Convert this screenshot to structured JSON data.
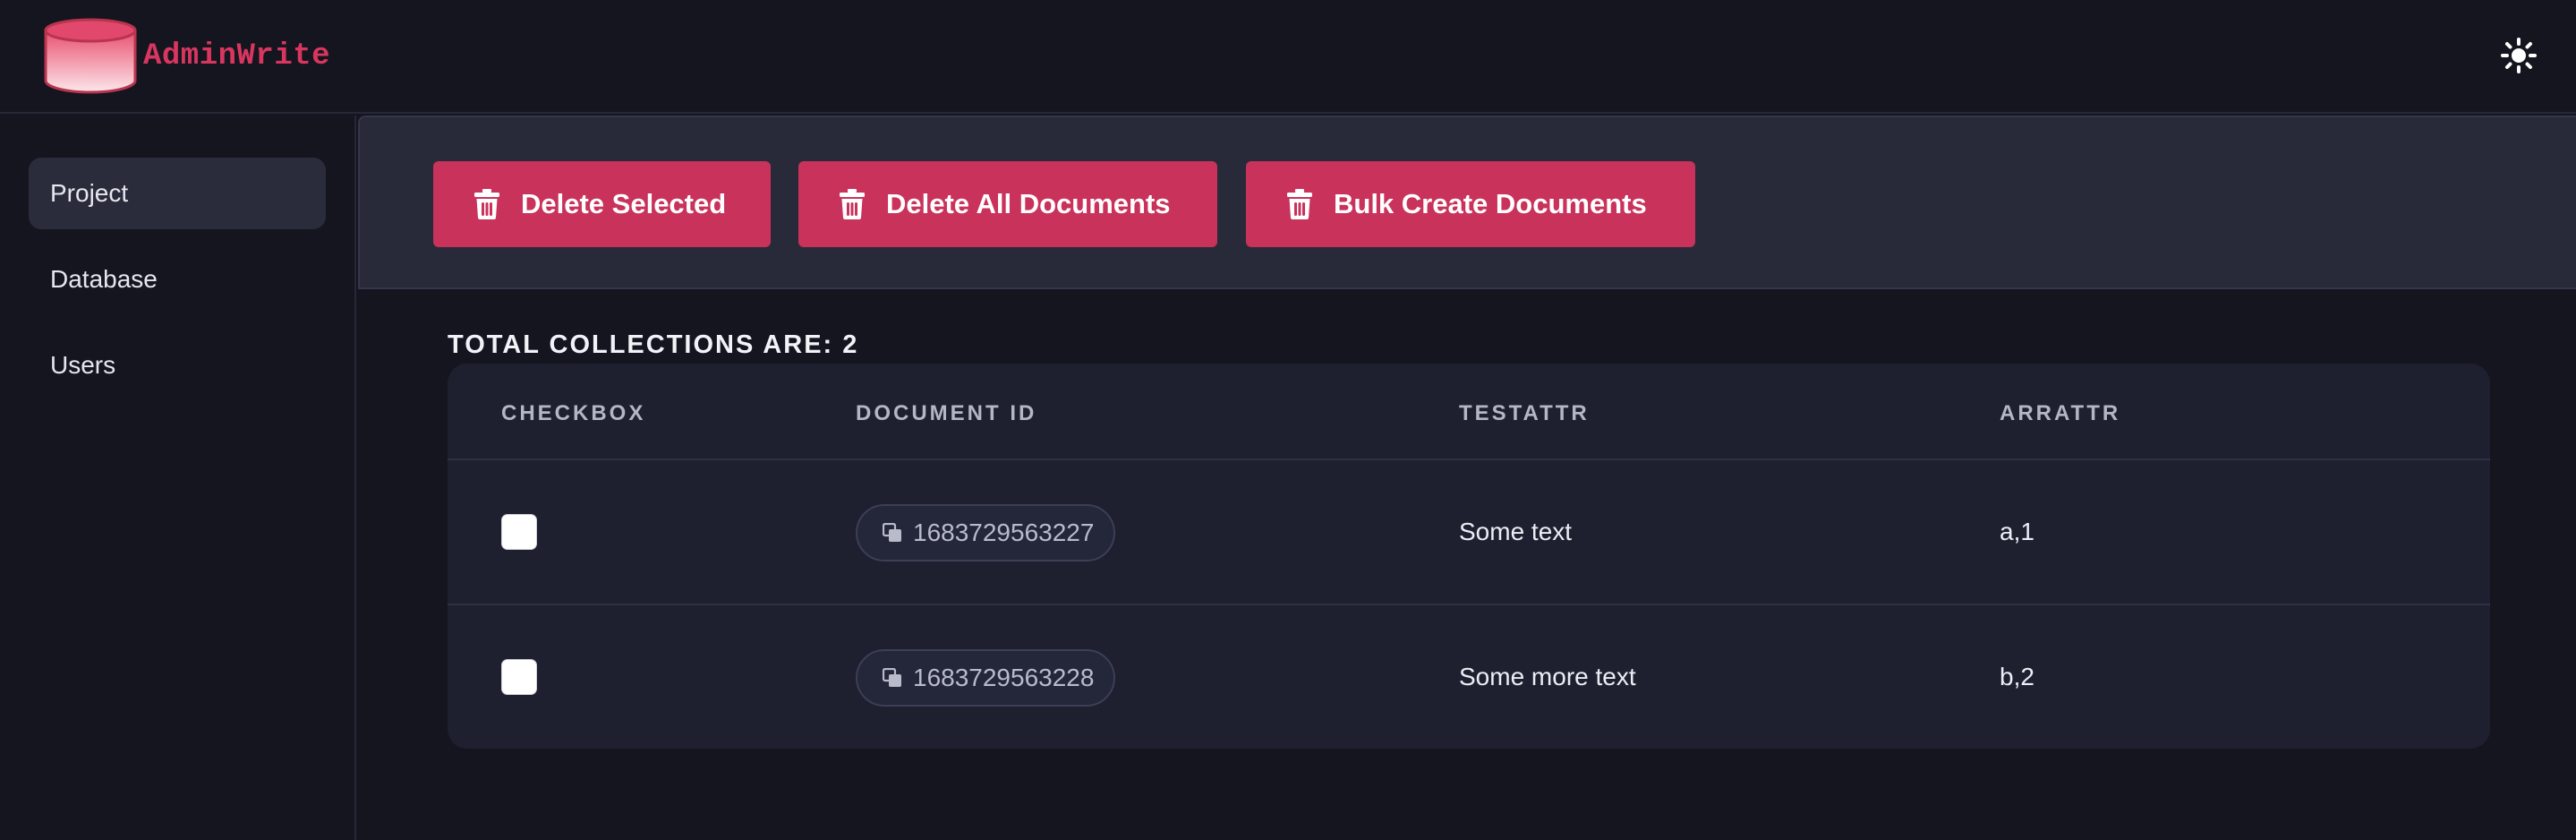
{
  "header": {
    "brand": "AdminWrite",
    "theme_icon": "sun-icon"
  },
  "sidebar": {
    "items": [
      {
        "label": "Project",
        "active": true
      },
      {
        "label": "Database",
        "active": false
      },
      {
        "label": "Users",
        "active": false
      }
    ]
  },
  "toolbar": {
    "delete_selected": "Delete Selected",
    "delete_all": "Delete All Documents",
    "bulk_create": "Bulk Create Documents",
    "button_icon": "trash-icon"
  },
  "summary": {
    "total": "TOTAL COLLECTIONS ARE: 2"
  },
  "table": {
    "columns": [
      "CHECKBOX",
      "DOCUMENT ID",
      "TESTATTR",
      "ARRATTR"
    ],
    "rows": [
      {
        "checked": false,
        "id": "1683729563227",
        "testattr": "Some text",
        "arrattr": "a,1"
      },
      {
        "checked": false,
        "id": "1683729563228",
        "testattr": "Some more text",
        "arrattr": "b,2"
      }
    ]
  },
  "colors": {
    "accent": "#c9325b",
    "brand": "#d8365f",
    "background": "#14151f",
    "panel": "#282a3a"
  }
}
